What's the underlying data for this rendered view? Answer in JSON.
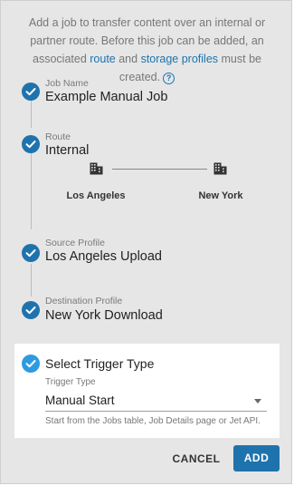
{
  "intro": {
    "text_before": "Add a job to transfer content over an internal or partner route. Before this job can be added, an associated ",
    "link_route": "route",
    "text_and": " and ",
    "link_profiles": "storage profiles",
    "text_after": " must be created.",
    "help_icon": "?"
  },
  "steps": [
    {
      "label": "Job Name",
      "value": "Example Manual Job",
      "icon": "check-icon"
    },
    {
      "label": "Route",
      "value": "Internal",
      "icon": "check-icon"
    },
    {
      "label": "Source Profile",
      "value": "Los Angeles Upload",
      "icon": "check-icon"
    },
    {
      "label": "Destination Profile",
      "value": "New York Download",
      "icon": "check-icon"
    }
  ],
  "route": {
    "source_city": "Los Angeles",
    "destination_city": "New York",
    "node_icon": "building-icon"
  },
  "trigger": {
    "title": "Select Trigger Type",
    "field_label": "Trigger Type",
    "selected": "Manual Start",
    "helper": "Start from the Jobs table, Job Details page or Jet API."
  },
  "actions": {
    "cancel": "CANCEL",
    "add": "ADD"
  },
  "colors": {
    "accent": "#1e73ad",
    "active_step": "#2d9be0",
    "background": "#e6e6e6"
  }
}
